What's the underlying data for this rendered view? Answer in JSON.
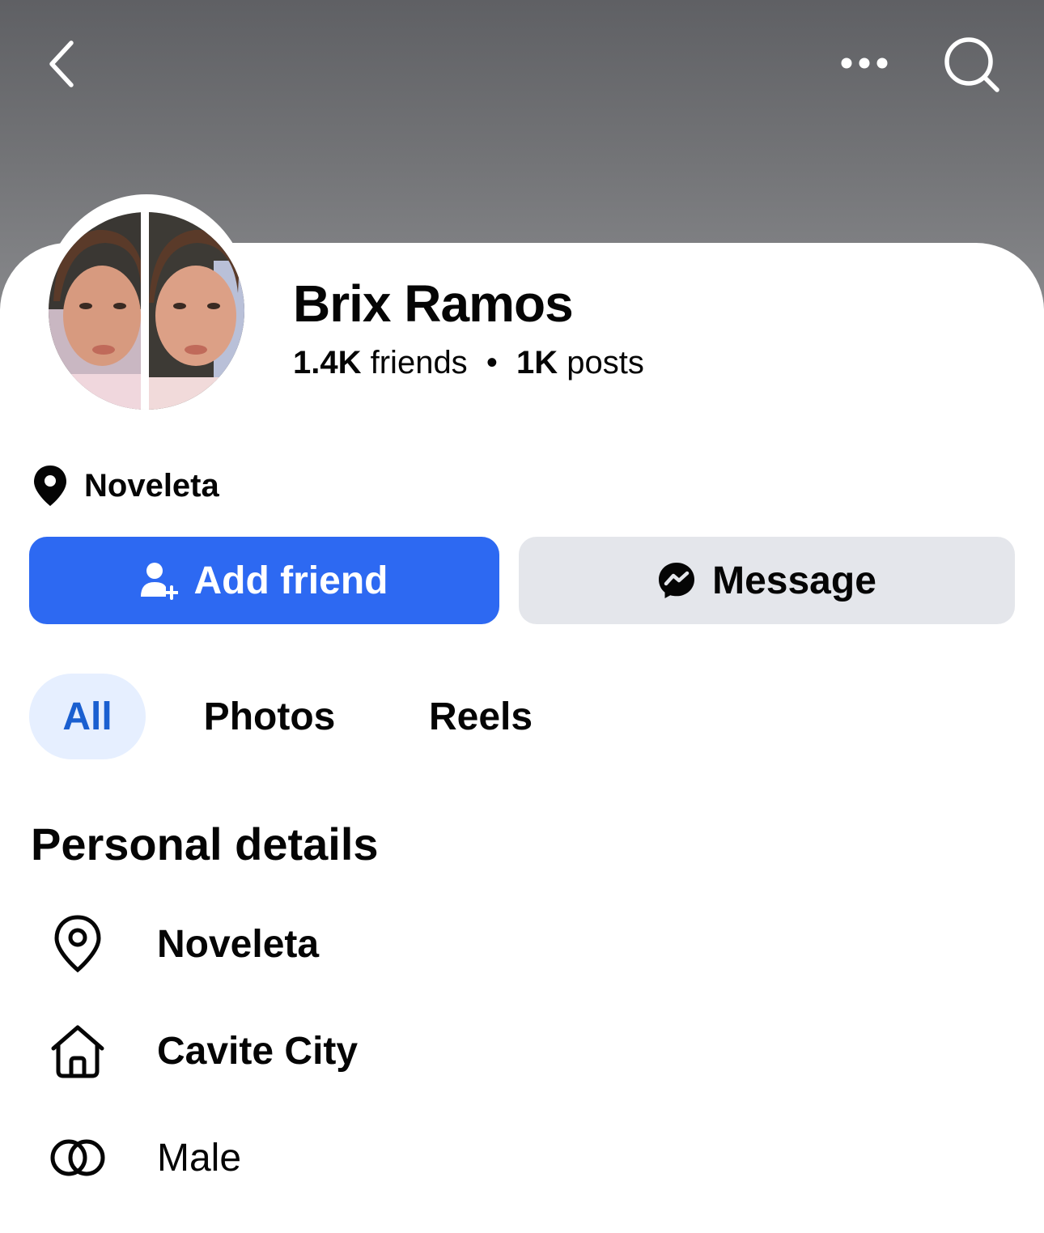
{
  "header": {
    "back_icon": "chevron-left-icon",
    "more_icon": "more-dots-icon",
    "search_icon": "search-icon"
  },
  "profile": {
    "name": "Brix Ramos",
    "friends_count": "1.4K",
    "friends_label": "friends",
    "separator": "•",
    "posts_count": "1K",
    "posts_label": "posts",
    "location": "Noveleta"
  },
  "actions": {
    "add_friend_label": "Add friend",
    "message_label": "Message",
    "colors": {
      "primary": "#2d69f2",
      "secondary": "#e4e6eb"
    }
  },
  "tabs": [
    {
      "label": "All",
      "active": true
    },
    {
      "label": "Photos",
      "active": false
    },
    {
      "label": "Reels",
      "active": false
    }
  ],
  "personal_details": {
    "title": "Personal details",
    "items": [
      {
        "icon": "location-pin-icon",
        "value": "Noveleta"
      },
      {
        "icon": "home-icon",
        "value": "Cavite City"
      },
      {
        "icon": "gender-icon",
        "value": "Male"
      }
    ]
  }
}
